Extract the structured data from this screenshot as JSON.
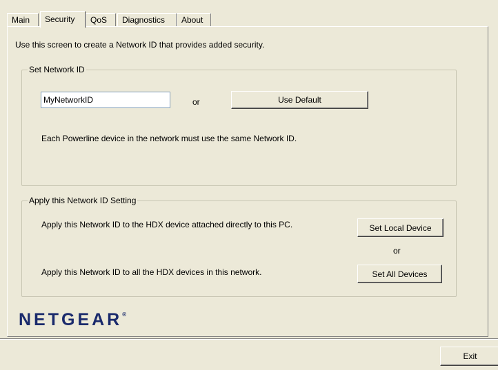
{
  "tabs": [
    {
      "label": "Main"
    },
    {
      "label": "Security"
    },
    {
      "label": "QoS"
    },
    {
      "label": "Diagnostics"
    },
    {
      "label": "About"
    }
  ],
  "intro_text": "Use this screen to create a Network ID that provides added security.",
  "set_network_id": {
    "legend": "Set Network ID",
    "input_value": "MyNetworkID",
    "or_label": "or",
    "use_default_label": "Use Default",
    "note": "Each Powerline device in the network must use the same Network ID."
  },
  "apply_setting": {
    "legend": "Apply this Network ID Setting",
    "local_text": "Apply this Network ID to the HDX device attached directly to this PC.",
    "set_local_label": "Set Local Device",
    "or_label": "or",
    "all_text": "Apply this Network ID to all the HDX devices in this network.",
    "set_all_label": "Set All Devices"
  },
  "brand": {
    "name": "NETGEAR",
    "mark": "®",
    "color": "#1a2a6c"
  },
  "footer": {
    "exit_label": "Exit"
  }
}
